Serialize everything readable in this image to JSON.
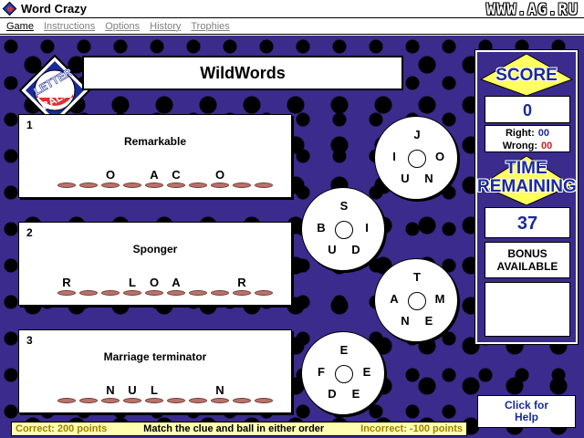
{
  "window": {
    "title": "Word Crazy",
    "watermark": "WWW.AG.RU"
  },
  "menu": [
    {
      "label": "Game",
      "enabled": true
    },
    {
      "label": "Instructions",
      "enabled": false
    },
    {
      "label": "Options",
      "enabled": false
    },
    {
      "label": "History",
      "enabled": false
    },
    {
      "label": "Trophies",
      "enabled": false
    }
  ],
  "logo": {
    "line1": "LETTER",
    "line2": "BALL"
  },
  "game": {
    "title": "WildWords"
  },
  "clues": [
    {
      "number": "1",
      "clue": "Remarkable",
      "slots": [
        "",
        "",
        "O",
        "",
        "A",
        "C",
        "",
        "O",
        "",
        ""
      ]
    },
    {
      "number": "2",
      "clue": "Sponger",
      "slots": [
        "R",
        "",
        "",
        "L",
        "O",
        "A",
        "",
        "",
        "R",
        ""
      ]
    },
    {
      "number": "3",
      "clue": "Marriage terminator",
      "slots": [
        "",
        "",
        "N",
        "U",
        "L",
        "",
        "",
        "N",
        "",
        ""
      ]
    }
  ],
  "balls": [
    {
      "top": "J",
      "left": "I",
      "right": "O",
      "bottom_left": "U",
      "bottom_right": "N"
    },
    {
      "top": "S",
      "left": "B",
      "right": "I",
      "bottom_left": "U",
      "bottom_right": "D"
    },
    {
      "top": "T",
      "left": "A",
      "right": "M",
      "bottom_left": "N",
      "bottom_right": "E"
    },
    {
      "top": "E",
      "left": "F",
      "right": "E",
      "bottom_left": "D",
      "bottom_right": "E"
    }
  ],
  "score": {
    "label": "SCORE",
    "value": "0",
    "right_label": "Right:",
    "right_value": "00",
    "wrong_label": "Wrong:",
    "wrong_value": "00"
  },
  "time": {
    "label_line1": "TIME",
    "label_line2": "REMAINING",
    "value": "37",
    "bonus_line1": "BONUS",
    "bonus_line2": "AVAILABLE"
  },
  "help": {
    "line1": "Click for",
    "line2": "Help"
  },
  "status": {
    "correct": "Correct: 200 points",
    "instruction": "Match the clue and ball in either order",
    "incorrect": "Incorrect: -100 points"
  },
  "colors": {
    "background": "#3a2b8c",
    "accent_text": "#1a2a9a",
    "banner_yellow": "#ffff60",
    "slot_mark": "#b9736a",
    "wrong_red": "#d02020",
    "status_bg": "#ffffb0"
  }
}
